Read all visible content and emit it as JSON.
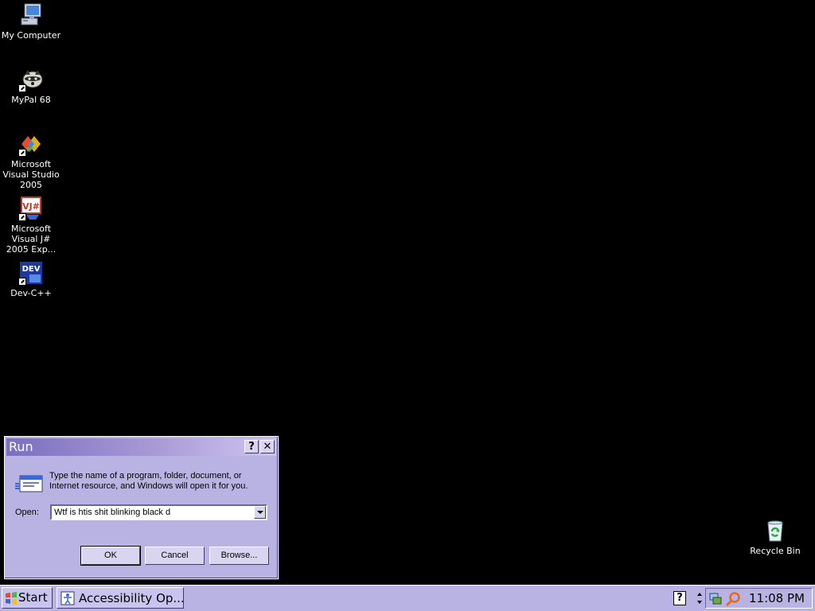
{
  "desktop": {
    "background": "#000000",
    "icons": [
      {
        "label": "My Computer"
      },
      {
        "label": "MyPal 68"
      },
      {
        "label": "Microsoft Visual Studio 2005"
      },
      {
        "label": "Microsoft Visual J# 2005 Exp..."
      },
      {
        "label": "Dev-C++"
      },
      {
        "label": "Recycle Bin"
      }
    ]
  },
  "run_dialog": {
    "title": "Run",
    "help_glyph": "?",
    "close_glyph": "✕",
    "description": "Type the name of a program, folder, document, or Internet resource, and Windows will open it for you.",
    "open_label": "Open:",
    "open_value": "Wtf is htis shit blinking black d",
    "ok_label": "OK",
    "cancel_label": "Cancel",
    "browse_label": "Browse..."
  },
  "taskbar": {
    "start_label": "Start",
    "task_label": "Accessibility Op...",
    "help_glyph": "?",
    "clock": "11:08 PM"
  },
  "colors": {
    "theme": "#b9b3e3",
    "title_gradient_start": "#7a6fc0",
    "title_gradient_end": "#cfc4ef"
  }
}
